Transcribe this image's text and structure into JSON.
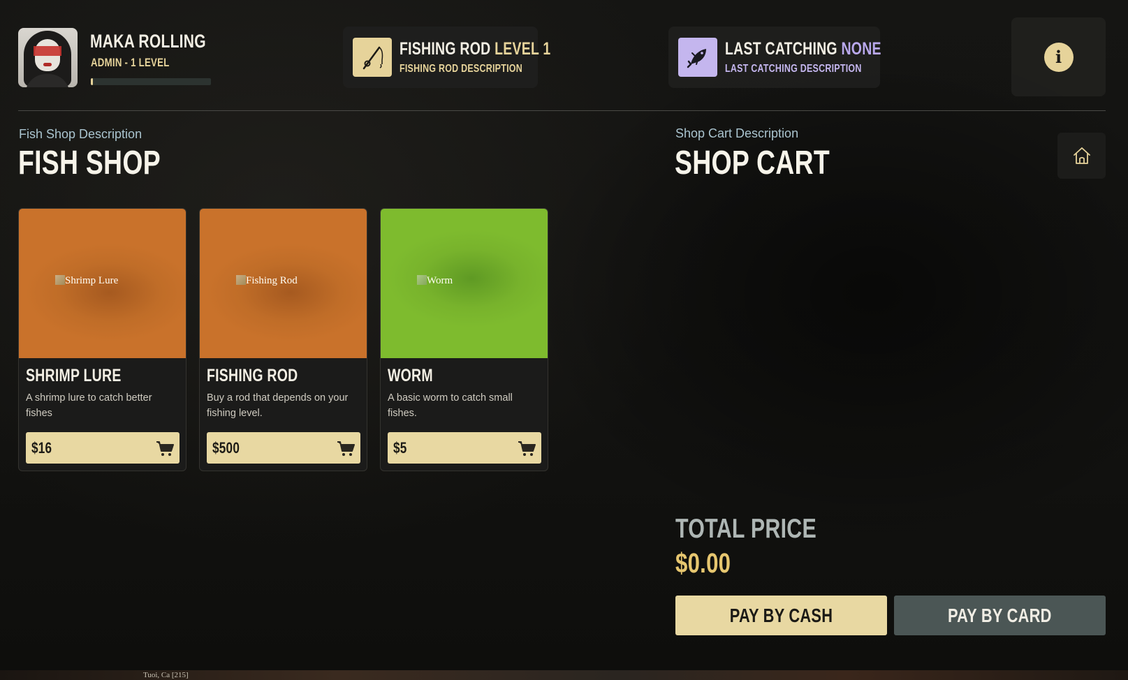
{
  "player": {
    "name": "MAKA ROLLING",
    "role": "ADMIN - 1 LEVEL",
    "xp_progress": 0.02
  },
  "rod": {
    "title": "FISHING ROD",
    "level": "LEVEL 1",
    "description": "FISHING ROD DESCRIPTION",
    "icon": "fishing-rod-icon"
  },
  "catching": {
    "title": "LAST CATCHING",
    "value": "NONE",
    "description": "LAST CATCHING DESCRIPTION",
    "icon": "fish-icon"
  },
  "shop": {
    "description": "Fish Shop Description",
    "title": "FISH SHOP",
    "items": [
      {
        "name": "SHRIMP LURE",
        "image_alt": "Shrimp Lure",
        "description": "A shrimp lure to catch better fishes",
        "price": "$16",
        "color": "orange"
      },
      {
        "name": "FISHING ROD",
        "image_alt": "Fishing Rod",
        "description": "Buy a rod that depends on your fishing level.",
        "price": "$500",
        "color": "orange"
      },
      {
        "name": "WORM",
        "image_alt": "Worm",
        "description": "A basic worm to catch small fishes.",
        "price": "$5",
        "color": "green"
      }
    ]
  },
  "cart": {
    "description": "Shop Cart Description",
    "title": "SHOP CART",
    "total_label": "TOTAL PRICE",
    "total_value": "$0.00",
    "pay_cash": "PAY BY CASH",
    "pay_card": "PAY BY CARD"
  },
  "colors": {
    "accent_gold": "#e6d39a",
    "accent_purple": "#c4b6ee",
    "price_gold": "#e6c66f",
    "card_button": "#4b5655"
  },
  "footer_text": "Tuoi, Ca [215]"
}
